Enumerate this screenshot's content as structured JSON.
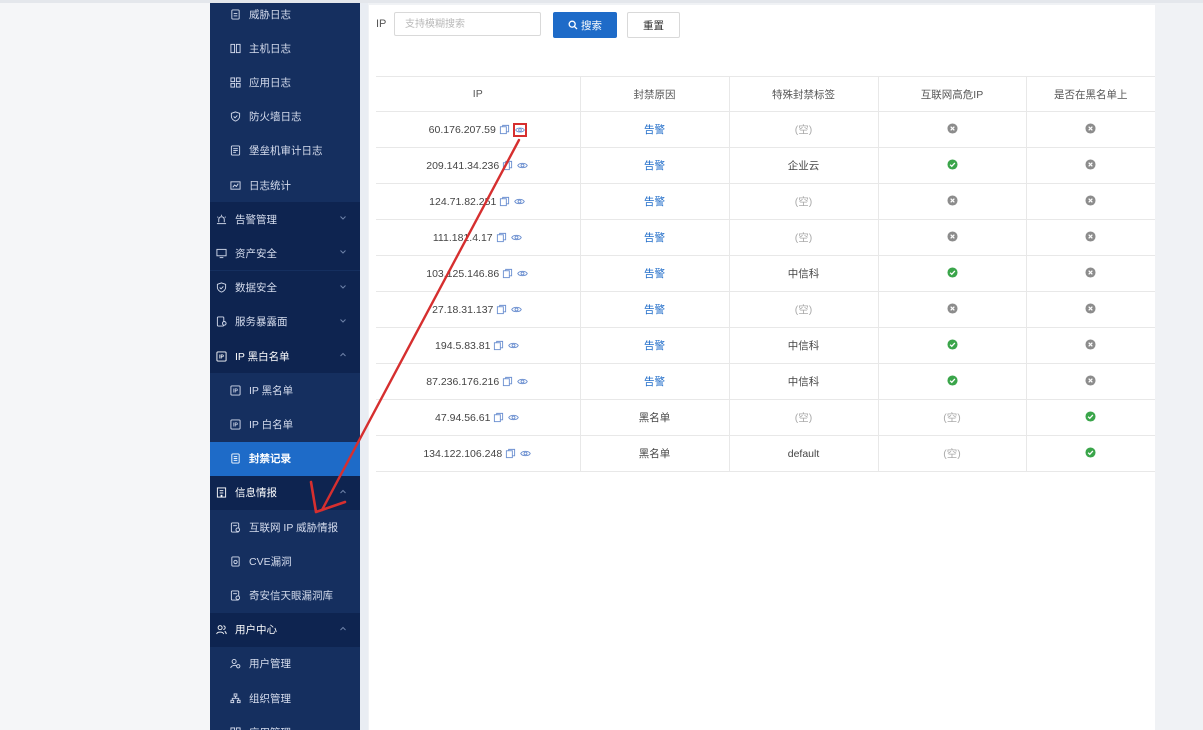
{
  "sidebar": {
    "items": [
      {
        "label": "威胁日志",
        "icon": "doc-icon",
        "kind": "sub"
      },
      {
        "label": "主机日志",
        "icon": "server-icon",
        "kind": "sub"
      },
      {
        "label": "应用日志",
        "icon": "grid-icon",
        "kind": "sub"
      },
      {
        "label": "防火墙日志",
        "icon": "shield-check-icon",
        "kind": "sub"
      },
      {
        "label": "堡垒机审计日志",
        "icon": "audit-icon",
        "kind": "sub"
      },
      {
        "label": "日志统计",
        "icon": "stats-icon",
        "kind": "sub"
      },
      {
        "label": "告警管理",
        "icon": "alarm-icon",
        "kind": "group"
      },
      {
        "label": "资产安全",
        "icon": "monitor-icon",
        "kind": "group"
      },
      {
        "label": "数据安全",
        "icon": "shield-icon",
        "kind": "group"
      },
      {
        "label": "服务暴露面",
        "icon": "service-icon",
        "kind": "group"
      },
      {
        "label": "IP 黑白名单",
        "icon": "ip-icon",
        "kind": "group-open"
      },
      {
        "label": "IP 黑名单",
        "icon": "ip-icon",
        "kind": "sub"
      },
      {
        "label": "IP 白名单",
        "icon": "ip-icon",
        "kind": "sub"
      },
      {
        "label": "封禁记录",
        "icon": "record-icon",
        "kind": "active"
      },
      {
        "label": "信息情报",
        "icon": "building-icon",
        "kind": "group-open"
      },
      {
        "label": "互联网 IP 威胁情报",
        "icon": "intel-icon",
        "kind": "sub"
      },
      {
        "label": "CVE漏洞",
        "icon": "cve-icon",
        "kind": "sub"
      },
      {
        "label": "奇安信天眼漏洞库",
        "icon": "intel-icon",
        "kind": "sub"
      },
      {
        "label": "用户中心",
        "icon": "users-icon",
        "kind": "group-open"
      },
      {
        "label": "用户管理",
        "icon": "user-manage-icon",
        "kind": "sub"
      },
      {
        "label": "组织管理",
        "icon": "org-icon",
        "kind": "sub"
      },
      {
        "label": "应用管理",
        "icon": "grid-icon",
        "kind": "sub"
      }
    ]
  },
  "search": {
    "label": "IP",
    "placeholder": "支持模糊搜索",
    "value": "",
    "search_button": "搜索",
    "reset_button": "重置"
  },
  "table": {
    "headers": [
      "IP",
      "封禁原因",
      "特殊封禁标签",
      "互联网高危IP",
      "是否在黑名单上"
    ],
    "rows": [
      {
        "ip": "60.176.207.59",
        "reason": "告警",
        "reason_link": true,
        "tag": "(空)",
        "high_risk": "no",
        "blacklisted": "no",
        "highlight": true
      },
      {
        "ip": "209.141.34.236",
        "reason": "告警",
        "reason_link": true,
        "tag": "企业云",
        "high_risk": "yes",
        "blacklisted": "no"
      },
      {
        "ip": "124.71.82.251",
        "reason": "告警",
        "reason_link": true,
        "tag": "(空)",
        "high_risk": "no",
        "blacklisted": "no"
      },
      {
        "ip": "111.181.4.17",
        "reason": "告警",
        "reason_link": true,
        "tag": "(空)",
        "high_risk": "no",
        "blacklisted": "no"
      },
      {
        "ip": "103.125.146.86",
        "reason": "告警",
        "reason_link": true,
        "tag": "中信科",
        "high_risk": "yes",
        "blacklisted": "no"
      },
      {
        "ip": "27.18.31.137",
        "reason": "告警",
        "reason_link": true,
        "tag": "(空)",
        "high_risk": "no",
        "blacklisted": "no"
      },
      {
        "ip": "194.5.83.81",
        "reason": "告警",
        "reason_link": true,
        "tag": "中信科",
        "high_risk": "yes",
        "blacklisted": "no"
      },
      {
        "ip": "87.236.176.216",
        "reason": "告警",
        "reason_link": true,
        "tag": "中信科",
        "high_risk": "yes",
        "blacklisted": "no"
      },
      {
        "ip": "47.94.56.61",
        "reason": "黑名单",
        "reason_link": false,
        "tag": "(空)",
        "high_risk": "(空)",
        "blacklisted": "yes"
      },
      {
        "ip": "134.122.106.248",
        "reason": "黑名单",
        "reason_link": false,
        "tag": "default",
        "high_risk": "(空)",
        "blacklisted": "yes"
      }
    ]
  },
  "colors": {
    "sidebar_bg": "#152f5f",
    "sidebar_group_bg": "#0e2450",
    "active_bg": "#1e6bc8",
    "link": "#1e6bc8",
    "status_yes": "#3aa54a",
    "status_no": "#8c8c8c",
    "annotation": "#d62f2f"
  }
}
